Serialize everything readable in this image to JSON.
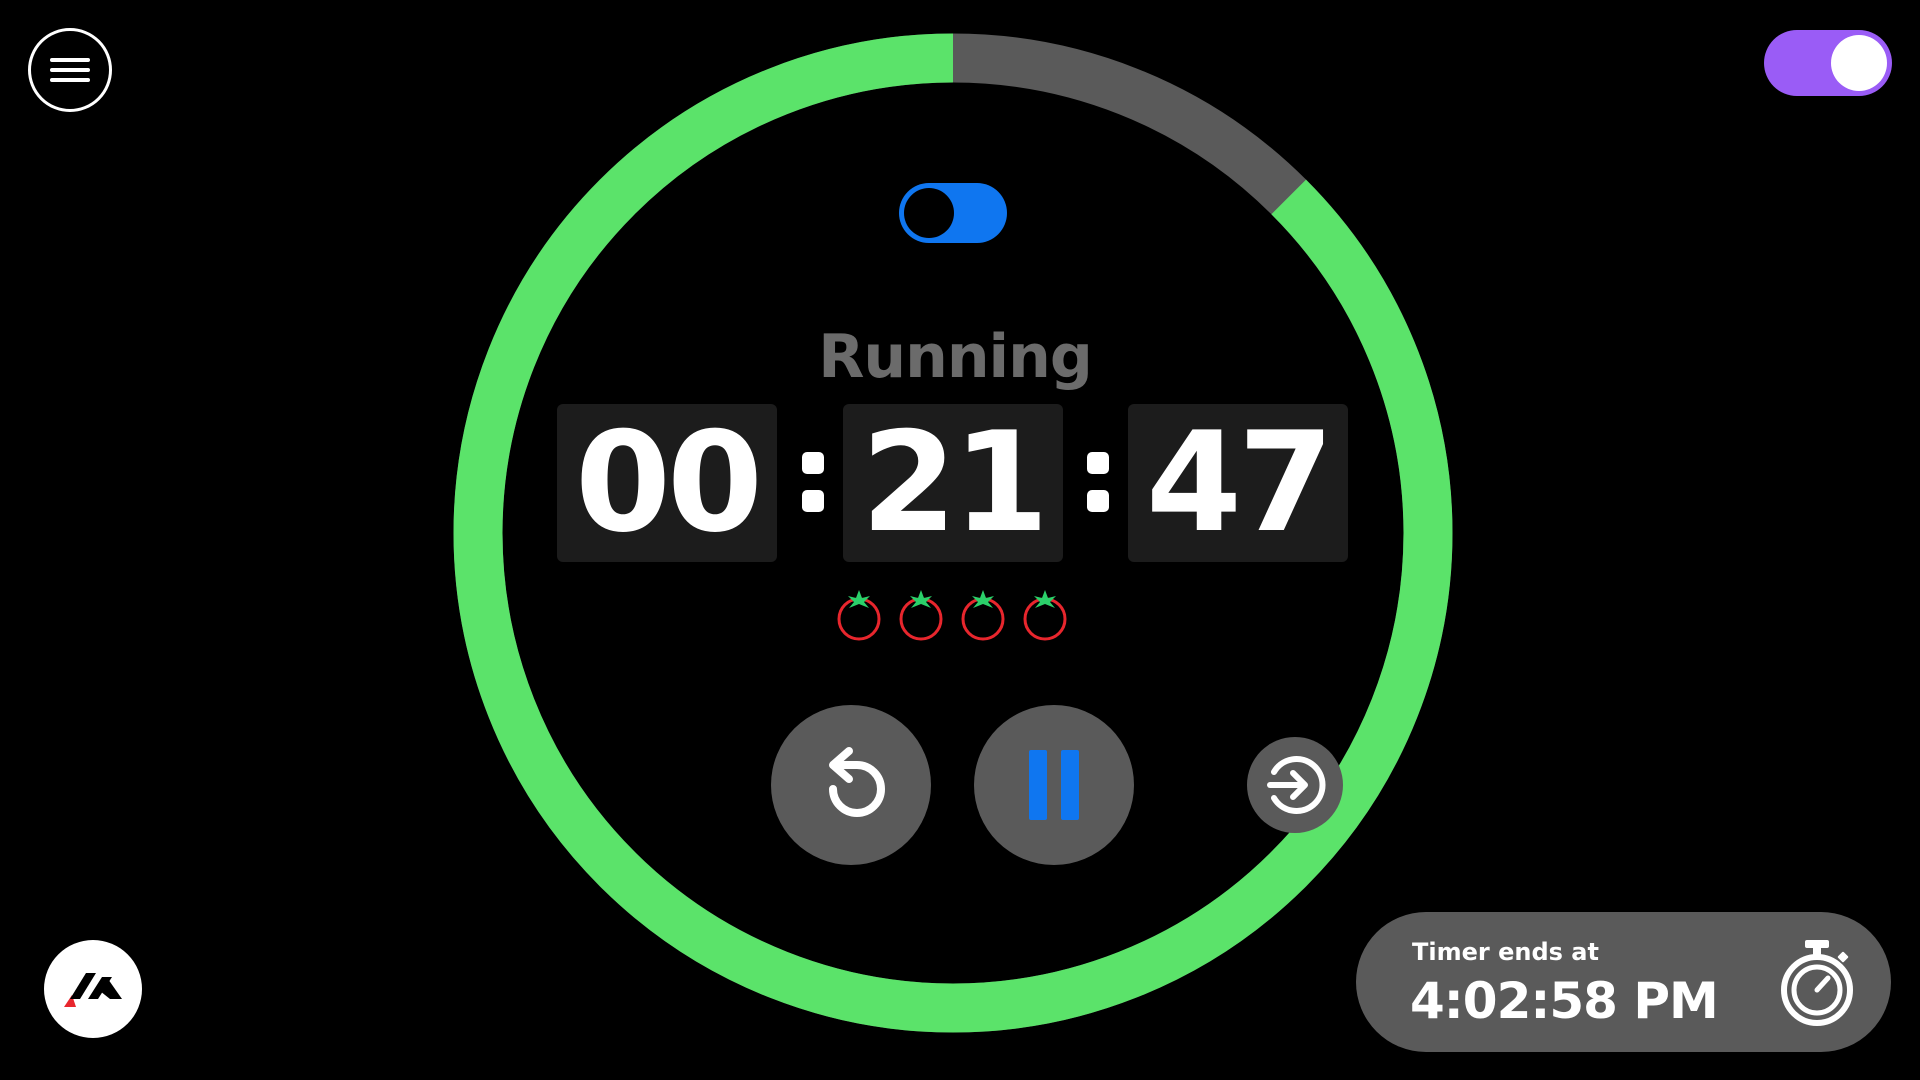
{
  "colors": {
    "ring_progress": "#5be36a",
    "ring_remaining": "#5a5a5a",
    "theme_toggle": "#9a5cf6",
    "mode_toggle": "#0f76f0",
    "pause_icon": "#0f76f0",
    "tomato_body": "#e8262d",
    "tomato_leaf": "#2bd06a",
    "logo_accent": "#e8262d"
  },
  "menu": {
    "icon": "hamburger-menu-icon"
  },
  "theme_toggle": {
    "state": "on"
  },
  "mode_toggle": {
    "state": "on"
  },
  "timer": {
    "status": "Running",
    "hours": "00",
    "minutes": "21",
    "seconds": "47",
    "remaining_fraction": 0.875,
    "completed_pomodoros": 4
  },
  "controls": {
    "reset": {
      "icon": "reset-icon"
    },
    "pause": {
      "icon": "pause-icon"
    },
    "skip": {
      "icon": "skip-icon"
    }
  },
  "ends": {
    "label": "Timer ends at",
    "time": "4:02:58 PM",
    "icon": "stopwatch-icon"
  },
  "logo": {
    "icon": "brand-logo-icon"
  }
}
